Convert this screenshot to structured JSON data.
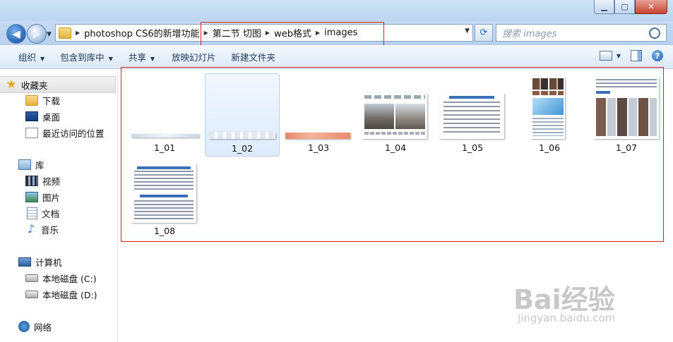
{
  "nav": {
    "back": "◀",
    "forward": "▶",
    "path": [
      "photoshop CS6的新增功能",
      "第二节 切图",
      "web格式",
      "images"
    ],
    "search_placeholder": "搜索 images"
  },
  "toolbar": {
    "organize": "组织",
    "include_in_library": "包含到库中",
    "share": "共享",
    "slideshow": "放映幻灯片",
    "new_folder": "新建文件夹"
  },
  "sidebar": {
    "favorites": "收藏夹",
    "downloads": "下载",
    "desktop": "桌面",
    "recent": "最近访问的位置",
    "libraries": "库",
    "videos": "视频",
    "pictures": "图片",
    "documents": "文档",
    "music": "音乐",
    "computer": "计算机",
    "disk_c": "本地磁盘 (C:)",
    "disk_d": "本地磁盘 (D:)",
    "network": "网络"
  },
  "files": [
    {
      "name": "1_01"
    },
    {
      "name": "1_02",
      "selected": true
    },
    {
      "name": "1_03"
    },
    {
      "name": "1_04"
    },
    {
      "name": "1_05"
    },
    {
      "name": "1_06"
    },
    {
      "name": "1_07"
    },
    {
      "name": "1_08"
    }
  ],
  "watermark": {
    "brand": "Bai经验",
    "url": "jingyan.baidu.com"
  },
  "colors": {
    "highlight_box": "#e0201a",
    "selection": "#dcebfc",
    "toolbar_text": "#1e395b"
  }
}
